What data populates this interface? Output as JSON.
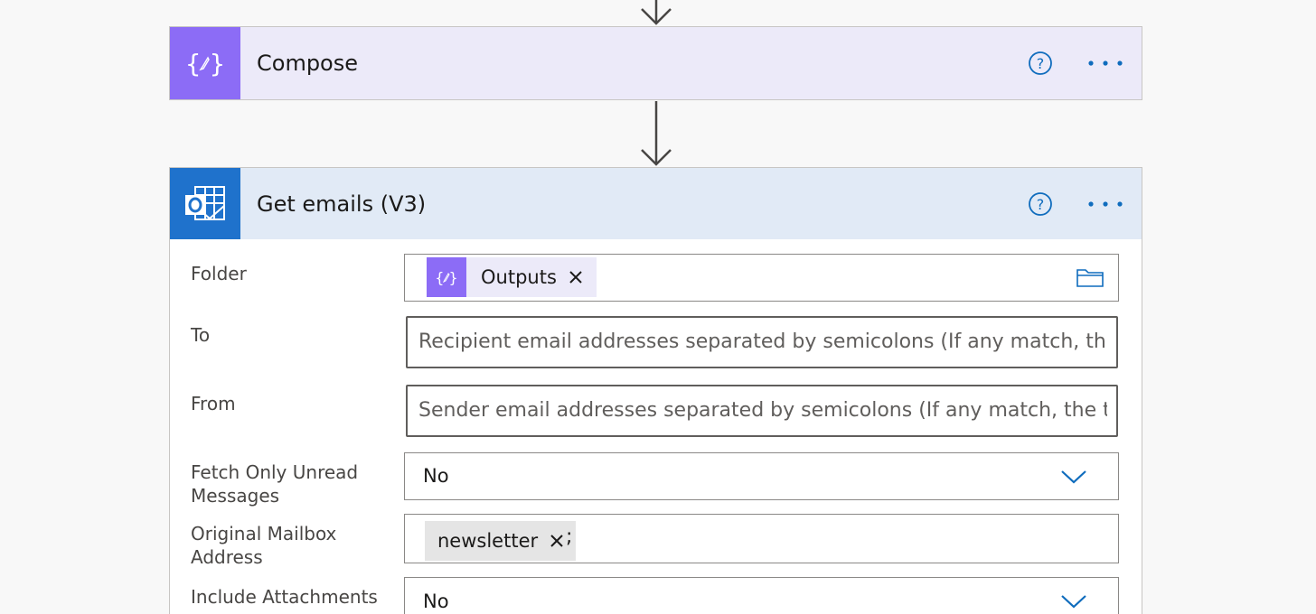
{
  "compose": {
    "title": "Compose",
    "icon": "compose-braces-pencil-icon",
    "tile_color": "#8c6cf6"
  },
  "get_emails": {
    "title": "Get emails (V3)",
    "icon": "outlook-icon",
    "tile_color": "#1f72cc",
    "fields": {
      "folder": {
        "label": "Folder",
        "token": "Outputs"
      },
      "to": {
        "label": "To",
        "placeholder": "Recipient email addresses separated by semicolons (If any match, the"
      },
      "from": {
        "label": "From",
        "placeholder": "Sender email addresses separated by semicolons (If any match, the tr"
      },
      "fetch_unread": {
        "label": "Fetch Only Unread Messages",
        "value": "No"
      },
      "original_mailbox": {
        "label": "Original Mailbox Address",
        "token": "newsletter",
        "suffix": ";"
      },
      "include_attachments": {
        "label": "Include Attachments",
        "value": "No"
      }
    }
  },
  "colors": {
    "accent": "#0f6cbd",
    "compose_header_bg": "#eceaf9",
    "email_header_bg": "#e1eaf6"
  }
}
